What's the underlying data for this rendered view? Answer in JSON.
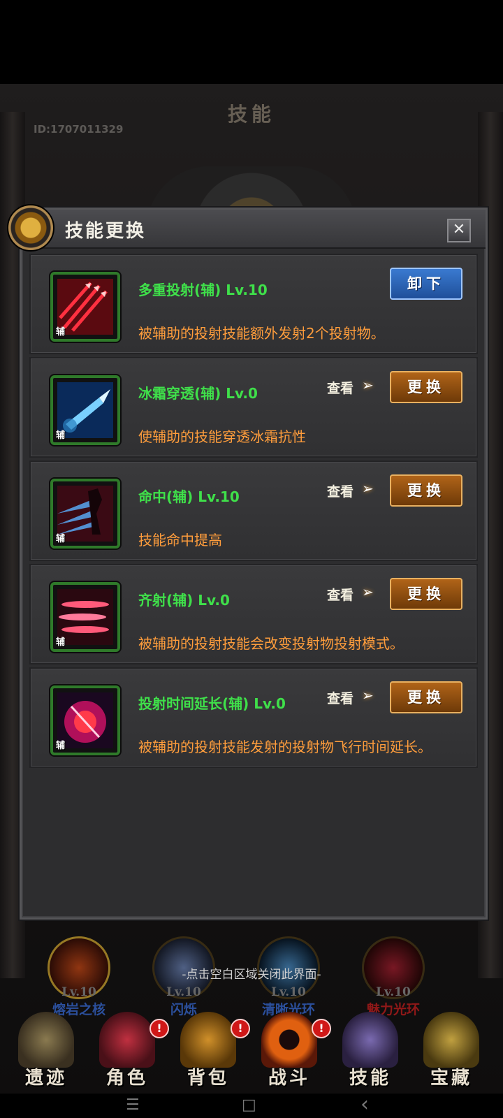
{
  "game": {
    "title": "技能",
    "player_id": "ID:1707011329"
  },
  "dialog": {
    "title": "技能更换",
    "close_label": "✕"
  },
  "skills": [
    {
      "name": "多重投射(辅) Lv.10",
      "desc": "被辅助的投射技能额外发射2个投射物。",
      "tag": "辅",
      "action": "卸下",
      "view": "",
      "icon": "multi-projectile-icon"
    },
    {
      "name": "冰霜穿透(辅) Lv.0",
      "desc": "使辅助的技能穿透冰霜抗性",
      "tag": "辅",
      "action": "更换",
      "view": "查看",
      "icon": "frost-penetration-icon"
    },
    {
      "name": "命中(辅) Lv.10",
      "desc": "技能命中提高",
      "tag": "辅",
      "action": "更换",
      "view": "查看",
      "icon": "accuracy-icon"
    },
    {
      "name": "齐射(辅) Lv.0",
      "desc": "被辅助的投射技能会改变投射物投射模式。",
      "tag": "辅",
      "action": "更换",
      "view": "查看",
      "icon": "volley-icon"
    },
    {
      "name": "投射时间延长(辅) Lv.0",
      "desc": "被辅助的投射技能发射的投射物飞行时间延长。",
      "tag": "辅",
      "action": "更换",
      "view": "查看",
      "icon": "projectile-duration-icon"
    }
  ],
  "hint": "-点击空白区域关闭此界面-",
  "equipped_skills": [
    {
      "level": "Lv.10",
      "name": "熔岩之核"
    },
    {
      "level": "Lv.10",
      "name": "闪烁"
    },
    {
      "level": "Lv.10",
      "name": "清晰光环"
    },
    {
      "level": "Lv.10",
      "name": "魅力光环"
    }
  ],
  "tabs": [
    {
      "label": "遗迹",
      "badge": ""
    },
    {
      "label": "角色",
      "badge": "!"
    },
    {
      "label": "背包",
      "badge": "!"
    },
    {
      "label": "战斗",
      "badge": "!"
    },
    {
      "label": "技能",
      "badge": ""
    },
    {
      "label": "宝藏",
      "badge": ""
    }
  ],
  "navbar": {
    "menu": "☰",
    "home": "□",
    "back": "‹"
  },
  "colors": {
    "skill_name": "#3fe04a",
    "skill_desc": "#ff9d3c",
    "equip_button": "#2a65b8",
    "swap_button": "#8a4a10",
    "icon_border": "#2f7a2a"
  }
}
